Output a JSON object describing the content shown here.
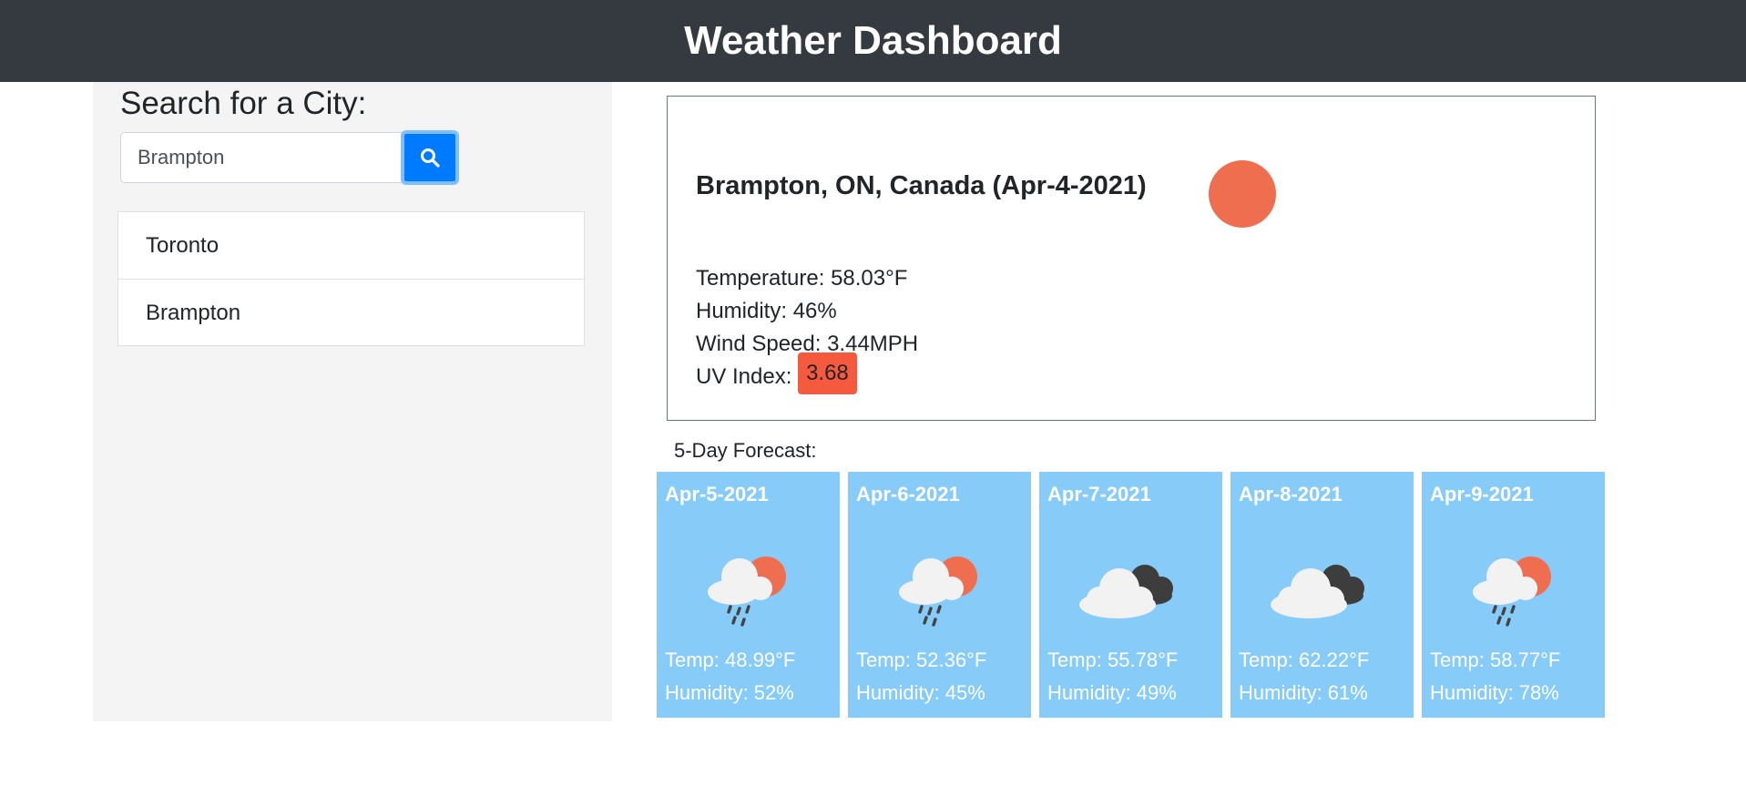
{
  "header": {
    "title": "Weather Dashboard"
  },
  "search": {
    "heading": "Search for a City:",
    "input_value": "Brampton",
    "placeholder": "",
    "button_icon": "search-icon"
  },
  "history": [
    "Toronto",
    "Brampton"
  ],
  "current": {
    "title": "Brampton, ON, Canada (Apr-4-2021)",
    "icon": "sun-icon",
    "temperature": "Temperature: 58.03°F",
    "humidity": "Humidity: 46%",
    "wind": "Wind Speed: 3.44MPH",
    "uv_label": "UV Index:",
    "uv_value": "3.68",
    "uv_color": "#f5593e"
  },
  "forecast": {
    "label": "5-Day Forecast:",
    "days": [
      {
        "date": "Apr-5-2021",
        "icon": "rain-sun-icon",
        "temp": "Temp: 48.99°F",
        "humidity": "Humidity: 52%"
      },
      {
        "date": "Apr-6-2021",
        "icon": "rain-sun-icon",
        "temp": "Temp: 52.36°F",
        "humidity": "Humidity: 45%"
      },
      {
        "date": "Apr-7-2021",
        "icon": "cloudy-icon",
        "temp": "Temp: 55.78°F",
        "humidity": "Humidity: 49%"
      },
      {
        "date": "Apr-8-2021",
        "icon": "cloudy-icon",
        "temp": "Temp: 62.22°F",
        "humidity": "Humidity: 61%"
      },
      {
        "date": "Apr-9-2021",
        "icon": "rain-sun-icon",
        "temp": "Temp: 58.77°F",
        "humidity": "Humidity: 78%"
      }
    ]
  },
  "colors": {
    "header_bg": "#343a40",
    "sidebar_bg": "#f4f4f4",
    "accent": "#007bff",
    "forecast_bg": "#87cbf9",
    "sun": "#ee6e4f"
  }
}
